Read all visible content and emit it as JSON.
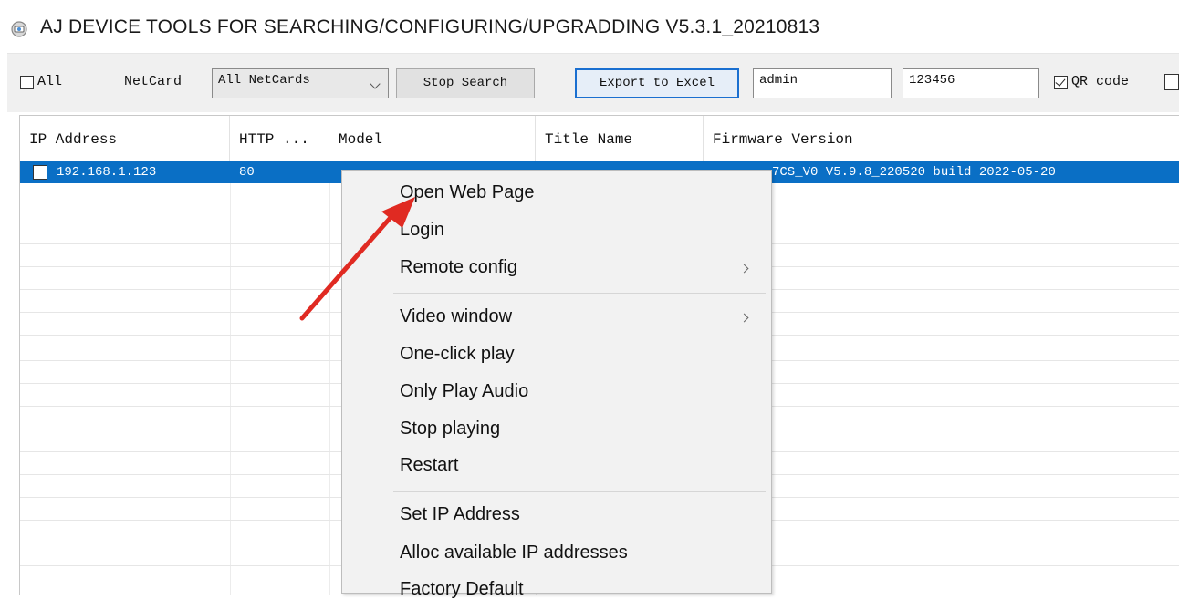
{
  "window": {
    "title": "AJ DEVICE TOOLS FOR SEARCHING/CONFIGURING/UPGRADDING V5.3.1_20210813"
  },
  "toolbar": {
    "all_label": "All",
    "netcard_label": "NetCard",
    "netcard_value": "All NetCards",
    "stop_search": "Stop Search",
    "export_excel": "Export to Excel",
    "username": "admin",
    "password": "123456",
    "qr_code": "QR code",
    "all_checked": false,
    "qr_checked": true
  },
  "table": {
    "columns": [
      "IP Address",
      "HTTP ...",
      "Model",
      "Title Name",
      "Firmware Version"
    ],
    "rows": [
      {
        "ip": "192.168.1.123",
        "http": "80",
        "model": "",
        "title_name": "",
        "firmware": "7CS_V0 V5.9.8_220520 build 2022-05-20"
      }
    ]
  },
  "context_menu": {
    "items": [
      {
        "label": "Open Web Page"
      },
      {
        "label": "Login"
      },
      {
        "label": "Remote config",
        "submenu": true
      },
      {
        "label": "Video window",
        "submenu": true
      },
      {
        "label": "One-click play"
      },
      {
        "label": "Only Play Audio"
      },
      {
        "label": "Stop playing"
      },
      {
        "label": "Restart"
      },
      {
        "label": "Set IP Address"
      },
      {
        "label": "Alloc available IP addresses"
      },
      {
        "label": "Factory Default"
      }
    ]
  },
  "colors": {
    "selection": "#0a6fc5",
    "annotation_arrow": "#e02a22",
    "focus_border": "#1a6fd0"
  },
  "icons": {
    "app": "device-tools-icon",
    "annotation": "red-arrow-icon"
  }
}
